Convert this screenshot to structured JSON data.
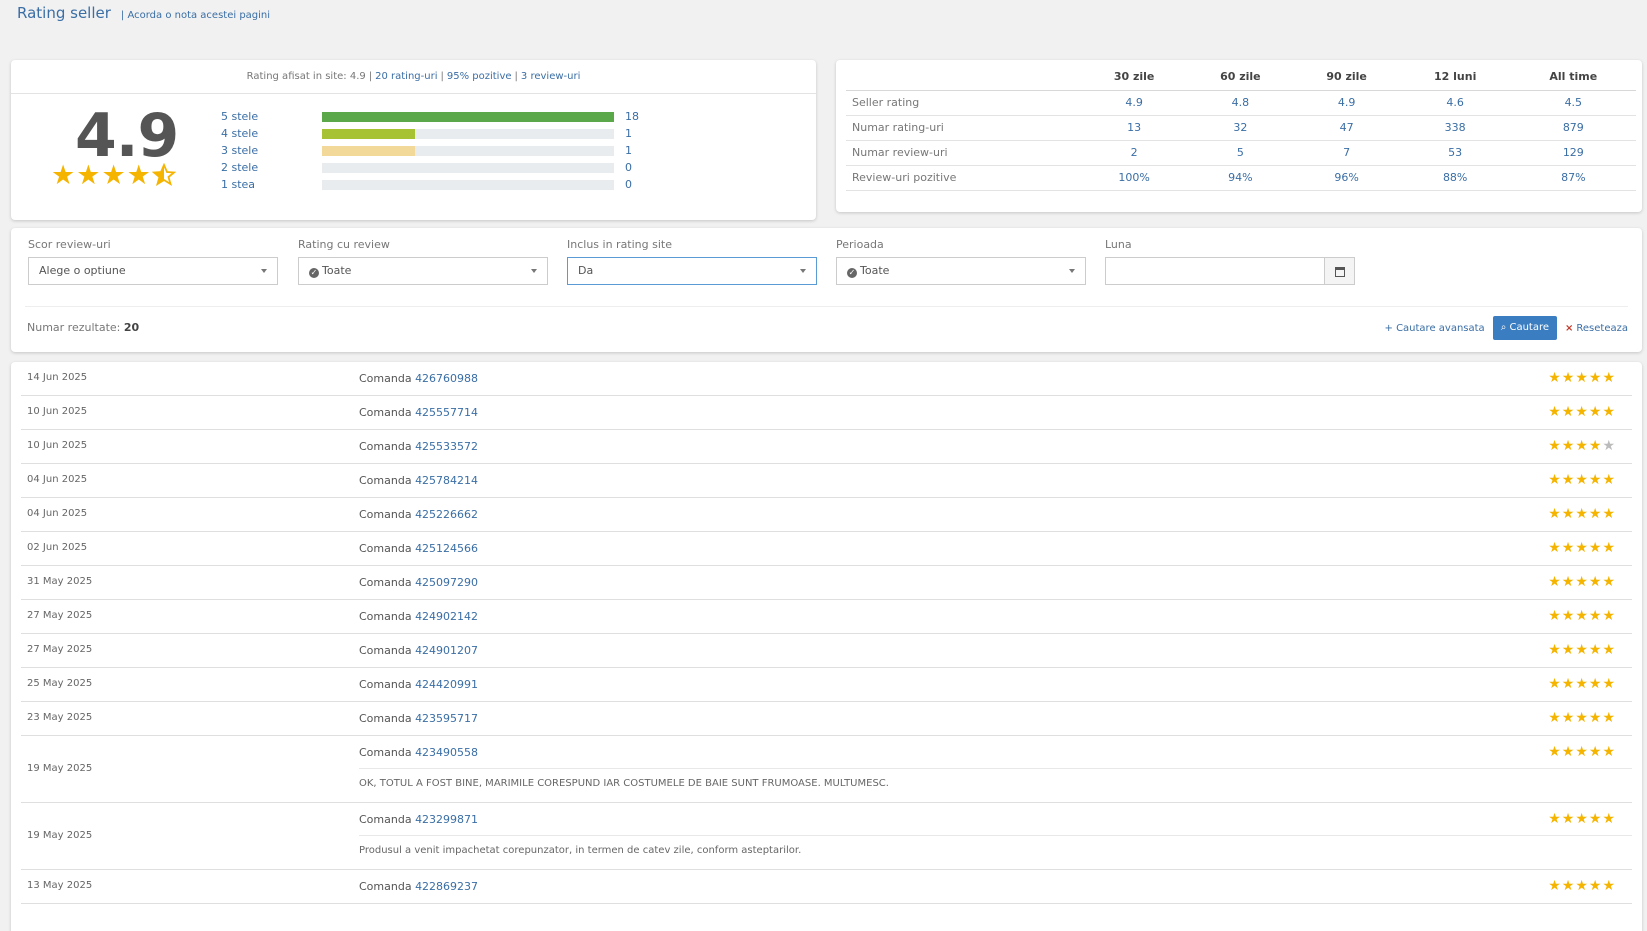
{
  "header": {
    "title": "Rating seller",
    "subtitle": "| Acorda o nota acestei pagini"
  },
  "summary": {
    "display_prefix": "Rating afisat in site: 4.9",
    "ratings_link": "20 rating-uri",
    "positive_link": "95% pozitive",
    "reviews_link": "3 review-uri",
    "score": "4.9",
    "bars": [
      {
        "label": "5 stele",
        "count": "18",
        "fill_fraction": 1.0,
        "color": "#5aa84a"
      },
      {
        "label": "4 stele",
        "count": "1",
        "fill_fraction": 0.32,
        "color": "#a7c232"
      },
      {
        "label": "3 stele",
        "count": "1",
        "fill_fraction": 0.32,
        "color": "#f2d99a"
      },
      {
        "label": "2 stele",
        "count": "0",
        "fill_fraction": 0,
        "color": "#e8ecef"
      },
      {
        "label": "1 stea",
        "count": "0",
        "fill_fraction": 0,
        "color": "#e8ecef"
      }
    ]
  },
  "stats": {
    "columns": [
      "30 zile",
      "60 zile",
      "90 zile",
      "12 luni",
      "All time"
    ],
    "rows": [
      {
        "label": "Seller rating",
        "values": [
          "4.9",
          "4.8",
          "4.9",
          "4.6",
          "4.5"
        ]
      },
      {
        "label": "Numar rating-uri",
        "values": [
          "13",
          "32",
          "47",
          "338",
          "879"
        ]
      },
      {
        "label": "Numar review-uri",
        "values": [
          "2",
          "5",
          "7",
          "53",
          "129"
        ]
      },
      {
        "label": "Review-uri pozitive",
        "values": [
          "100%",
          "94%",
          "96%",
          "88%",
          "87%"
        ]
      }
    ]
  },
  "filters": {
    "score_label": "Scor review-uri",
    "score_value": "Alege o optiune",
    "rating_label": "Rating cu review",
    "rating_value": "Toate",
    "inclus_label": "Inclus in rating site",
    "inclus_value": "Da",
    "perioada_label": "Perioada",
    "perioada_value": "Toate",
    "luna_label": "Luna",
    "results_label": "Numar rezultate:",
    "results_count": "20",
    "advanced": "Cautare avansata",
    "search": "Cautare",
    "reset": "Reseteaza"
  },
  "reviews": [
    {
      "date": "14 Jun 2025",
      "prefix": "Comanda",
      "order": "426760988",
      "stars": 5,
      "comment": ""
    },
    {
      "date": "10 Jun 2025",
      "prefix": "Comanda",
      "order": "425557714",
      "stars": 5,
      "comment": ""
    },
    {
      "date": "10 Jun 2025",
      "prefix": "Comanda",
      "order": "425533572",
      "stars": 4,
      "comment": ""
    },
    {
      "date": "04 Jun 2025",
      "prefix": "Comanda",
      "order": "425784214",
      "stars": 5,
      "comment": ""
    },
    {
      "date": "04 Jun 2025",
      "prefix": "Comanda",
      "order": "425226662",
      "stars": 5,
      "comment": ""
    },
    {
      "date": "02 Jun 2025",
      "prefix": "Comanda",
      "order": "425124566",
      "stars": 5,
      "comment": ""
    },
    {
      "date": "31 May 2025",
      "prefix": "Comanda",
      "order": "425097290",
      "stars": 5,
      "comment": ""
    },
    {
      "date": "27 May 2025",
      "prefix": "Comanda",
      "order": "424902142",
      "stars": 5,
      "comment": ""
    },
    {
      "date": "27 May 2025",
      "prefix": "Comanda",
      "order": "424901207",
      "stars": 5,
      "comment": ""
    },
    {
      "date": "25 May 2025",
      "prefix": "Comanda",
      "order": "424420991",
      "stars": 5,
      "comment": ""
    },
    {
      "date": "23 May 2025",
      "prefix": "Comanda",
      "order": "423595717",
      "stars": 5,
      "comment": ""
    },
    {
      "date": "19 May 2025",
      "prefix": "Comanda",
      "order": "423490558",
      "stars": 5,
      "comment": "OK, TOTUL A FOST BINE, MARIMILE CORESPUND IAR COSTUMELE DE BAIE SUNT FRUMOASE. MULTUMESC."
    },
    {
      "date": "19 May 2025",
      "prefix": "Comanda",
      "order": "423299871",
      "stars": 5,
      "comment": "Produsul a venit impachetat corepunzator, in termen de catev zile, conform asteptarilor."
    },
    {
      "date": "13 May 2025",
      "prefix": "Comanda",
      "order": "422869237",
      "stars": 5,
      "comment": ""
    }
  ]
}
